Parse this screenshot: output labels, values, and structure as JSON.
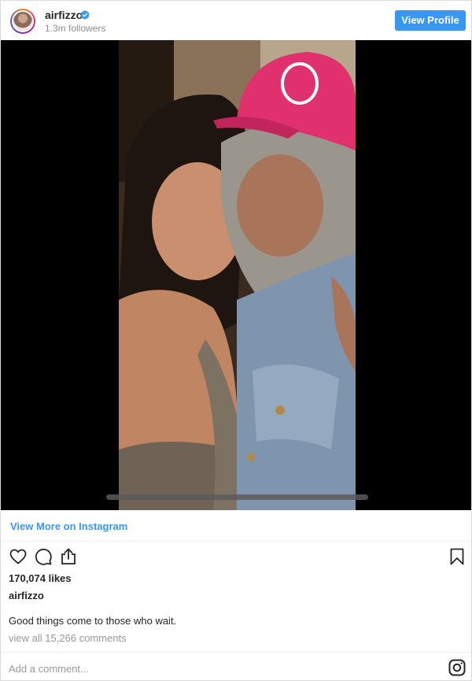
{
  "header": {
    "username": "airfizzo",
    "followers": "1.3m followers",
    "view_profile_label": "View Profile",
    "verified_color": "#3897f0"
  },
  "media": {
    "type": "video",
    "description_icon": "photo"
  },
  "links": {
    "view_more": "View More on Instagram"
  },
  "actions": {
    "icons": [
      "heart-icon",
      "comment-icon",
      "share-icon",
      "bookmark-icon"
    ]
  },
  "post": {
    "likes": "170,074 likes",
    "caption_user": "airfizzo",
    "caption": "Good things come to those who wait.",
    "view_comments": "view all 15,266 comments"
  },
  "comment_box": {
    "placeholder": "Add a comment..."
  },
  "colors": {
    "accent": "#3897f0",
    "text": "#262626",
    "muted": "#999999"
  }
}
